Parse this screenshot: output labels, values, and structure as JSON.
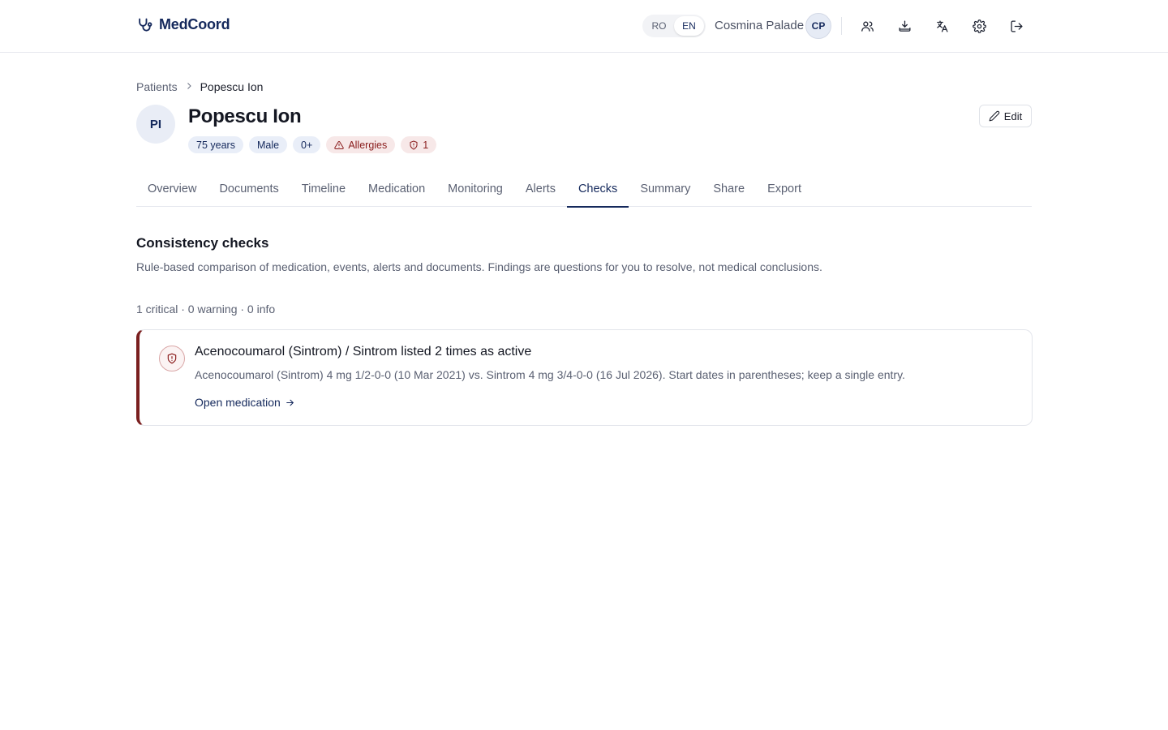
{
  "app": {
    "name": "MedCoord"
  },
  "header": {
    "languages": [
      "RO",
      "EN"
    ],
    "active_language": "EN",
    "user_name": "Cosmina Palade",
    "user_initials": "CP",
    "icons": [
      "users-icon",
      "download-icon",
      "translate-icon",
      "gear-icon",
      "logout-icon"
    ]
  },
  "breadcrumb": {
    "parent": "Patients",
    "current": "Popescu Ion"
  },
  "patient": {
    "initials": "PI",
    "name": "Popescu Ion",
    "chips": {
      "age": "75 years",
      "sex": "Male",
      "blood": "0+",
      "allergies": "Allergies",
      "alerts_count": "1"
    },
    "edit_label": "Edit"
  },
  "tabs": [
    {
      "label": "Overview"
    },
    {
      "label": "Documents"
    },
    {
      "label": "Timeline"
    },
    {
      "label": "Medication"
    },
    {
      "label": "Monitoring"
    },
    {
      "label": "Alerts"
    },
    {
      "label": "Checks"
    },
    {
      "label": "Summary"
    },
    {
      "label": "Share"
    },
    {
      "label": "Export"
    }
  ],
  "active_tab": "Checks",
  "checks": {
    "title": "Consistency checks",
    "description": "Rule-based comparison of medication, events, alerts and documents. Findings are questions for you to resolve, not medical conclusions.",
    "summary": "1 critical · 0 warning · 0 info",
    "findings": [
      {
        "severity": "critical",
        "title": "Acenocoumarol (Sintrom) / Sintrom listed 2 times as active",
        "detail": "Acenocoumarol (Sintrom) 4 mg 1/2-0-0 (10 Mar 2021) vs. Sintrom 4 mg 3/4-0-0 (16 Jul 2026). Start dates in parentheses; keep a single entry.",
        "link": "Open medication"
      }
    ]
  },
  "colors": {
    "brand": "#15295c",
    "critical": "#7a1f1f",
    "danger_chip_bg": "#f7e8e8",
    "chip_bg": "#e9eef8"
  }
}
